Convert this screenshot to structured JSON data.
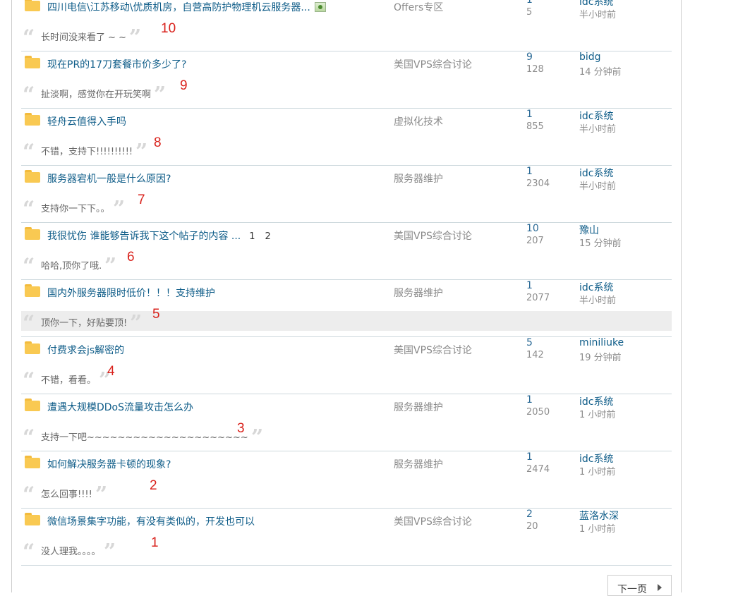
{
  "threads": [
    {
      "title": "四川电信\\江苏移动\\优质机房，自营高防护物理机云服务器...",
      "has_image": true,
      "pages": [],
      "forum": "Offers专区",
      "replies": "1",
      "views": "5",
      "last_user": "idc系统",
      "last_time": "半小时前",
      "quote": "长时间没来看了 ~ ~",
      "marker": "10",
      "highlight": false
    },
    {
      "title": "现在PR的17刀套餐市价多少了?",
      "has_image": false,
      "pages": [],
      "forum": "美国VPS综合讨论",
      "replies": "9",
      "views": "128",
      "last_user": "bidg",
      "last_time": "14 分钟前",
      "quote": "扯淡啊，感觉你在开玩笑啊",
      "marker": "9",
      "highlight": false
    },
    {
      "title": "轻舟云值得入手吗",
      "has_image": false,
      "pages": [],
      "forum": "虚拟化技术",
      "replies": "1",
      "views": "855",
      "last_user": "idc系统",
      "last_time": "半小时前",
      "quote": "不错，支持下!!!!!!!!!!",
      "marker": "8",
      "highlight": false
    },
    {
      "title": "服务器宕机一般是什么原因?",
      "has_image": false,
      "pages": [],
      "forum": "服务器维护",
      "replies": "1",
      "views": "2304",
      "last_user": "idc系统",
      "last_time": "半小时前",
      "quote": "支持你一下下。。",
      "marker": "7",
      "highlight": false
    },
    {
      "title": "我很忧伤 谁能够告诉我下这个帖子的内容 ...",
      "has_image": false,
      "pages": [
        "1",
        "2"
      ],
      "forum": "美国VPS综合讨论",
      "replies": "10",
      "views": "207",
      "last_user": "豫山",
      "last_time": "15 分钟前",
      "quote": "哈哈,顶你了哦.",
      "marker": "6",
      "highlight": false
    },
    {
      "title": "国内外服务器限时低价！！！支持维护",
      "has_image": false,
      "pages": [],
      "forum": "服务器维护",
      "replies": "1",
      "views": "2077",
      "last_user": "idc系统",
      "last_time": "半小时前",
      "quote": "顶你一下，好贴要顶!",
      "marker": "5",
      "highlight": true
    },
    {
      "title": "付费求会js解密的",
      "has_image": false,
      "pages": [],
      "forum": "美国VPS综合讨论",
      "replies": "5",
      "views": "142",
      "last_user": "miniliuke",
      "last_time": "19 分钟前",
      "quote": "不错，看看。",
      "marker": "4",
      "highlight": false
    },
    {
      "title": "遭遇大规模DDoS流量攻击怎么办",
      "has_image": false,
      "pages": [],
      "forum": "服务器维护",
      "replies": "1",
      "views": "2050",
      "last_user": "idc系统",
      "last_time": "1 小时前",
      "quote": "支持一下吧~~~~~~~~~~~~~~~~~~~~~",
      "marker": "3",
      "highlight": false
    },
    {
      "title": "如何解决服务器卡顿的现象?",
      "has_image": false,
      "pages": [],
      "forum": "服务器维护",
      "replies": "1",
      "views": "2474",
      "last_user": "idc系统",
      "last_time": "1 小时前",
      "quote": "怎么回事!!!!",
      "marker": "2",
      "highlight": false
    },
    {
      "title": "微信场景集字功能，有没有类似的，开发也可以",
      "has_image": false,
      "pages": [],
      "forum": "美国VPS综合讨论",
      "replies": "2",
      "views": "20",
      "last_user": "蓝洛水深",
      "last_time": "1 小时前",
      "quote": "没人理我。。。。",
      "marker": "1",
      "highlight": false
    }
  ],
  "pagination": {
    "next_label": "下一页"
  },
  "icons": {
    "thread": "folder-icon",
    "attachment": "image-attachment-icon",
    "next": "chevron-right-icon",
    "quote_open": "quote-open-icon",
    "quote_close": "quote-close-icon"
  },
  "colors": {
    "link": "#0e5c88",
    "muted": "#8d8d8d",
    "marker": "#d9221c",
    "folder": "#f9c952",
    "highlight_row": "#ededed"
  }
}
